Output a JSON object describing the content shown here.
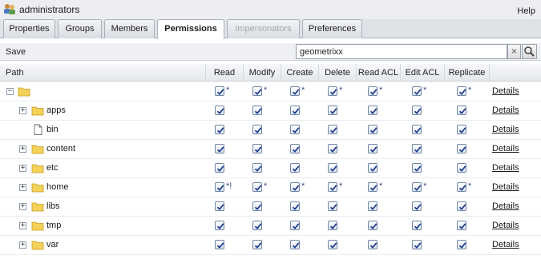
{
  "window": {
    "title": "administrators",
    "help_label": "Help",
    "user_icon": "user-group-icon"
  },
  "tabs": [
    {
      "label": "Properties",
      "active": false,
      "disabled": false
    },
    {
      "label": "Groups",
      "active": false,
      "disabled": false
    },
    {
      "label": "Members",
      "active": false,
      "disabled": false
    },
    {
      "label": "Permissions",
      "active": true,
      "disabled": false
    },
    {
      "label": "Impersonators",
      "active": false,
      "disabled": true
    },
    {
      "label": "Preferences",
      "active": false,
      "disabled": false
    }
  ],
  "toolbar": {
    "save_label": "Save",
    "search_value": "geometrixx",
    "clear_label": "×"
  },
  "table": {
    "headers": [
      "Path",
      "Read",
      "Modify",
      "Create",
      "Delete",
      "Read ACL",
      "Edit ACL",
      "Replicate"
    ],
    "details_label": "Details",
    "rows": [
      {
        "label": "",
        "kind": "folder",
        "toggle": "−",
        "marks": [
          "*",
          "*",
          "*",
          "*",
          "*",
          "*",
          "*"
        ]
      },
      {
        "label": "apps",
        "kind": "folder",
        "toggle": "+",
        "marks": [
          "",
          "",
          "",
          "",
          "",
          "",
          ""
        ]
      },
      {
        "label": "bin",
        "kind": "file",
        "toggle": "",
        "marks": [
          "",
          "",
          "",
          "",
          "",
          "",
          ""
        ]
      },
      {
        "label": "content",
        "kind": "folder",
        "toggle": "+",
        "marks": [
          "",
          "",
          "",
          "",
          "",
          "",
          ""
        ]
      },
      {
        "label": "etc",
        "kind": "folder",
        "toggle": "+",
        "marks": [
          "",
          "",
          "",
          "",
          "",
          "",
          ""
        ]
      },
      {
        "label": "home",
        "kind": "folder",
        "toggle": "+",
        "marks": [
          "*!",
          "*",
          "*",
          "*",
          "*",
          "*",
          "*"
        ]
      },
      {
        "label": "libs",
        "kind": "folder",
        "toggle": "+",
        "marks": [
          "",
          "",
          "",
          "",
          "",
          "",
          ""
        ]
      },
      {
        "label": "tmp",
        "kind": "folder",
        "toggle": "+",
        "marks": [
          "",
          "",
          "",
          "",
          "",
          "",
          ""
        ]
      },
      {
        "label": "var",
        "kind": "folder",
        "toggle": "+",
        "marks": [
          "",
          "",
          "",
          "",
          "",
          "",
          ""
        ]
      }
    ]
  },
  "colors": {
    "folder": "#f4d25a",
    "check": "#1f3c8c",
    "active_tab": "#ffffff"
  }
}
